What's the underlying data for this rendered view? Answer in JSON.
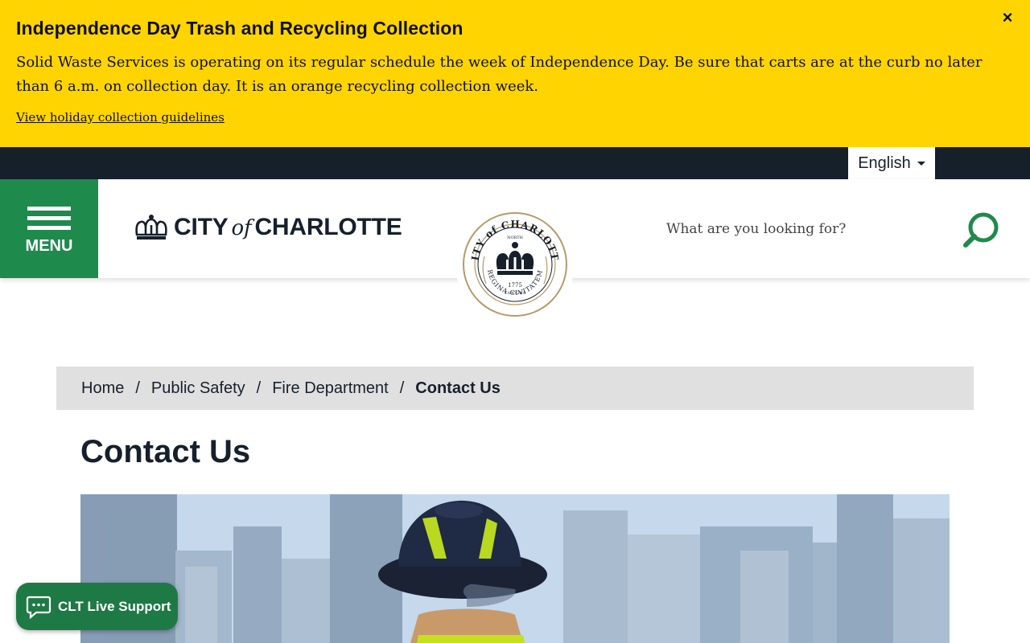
{
  "alert": {
    "title": "Independence Day Trash and Recycling Collection",
    "body": "Solid Waste Services is operating on its regular schedule the week of Independence Day. Be sure that carts are at the curb no later than 6 a.m. on collection day. It is an orange recycling collection week.",
    "link": "View holiday collection guidelines",
    "close_icon": "×",
    "bg_color": "#ffd400"
  },
  "utility": {
    "language": "English"
  },
  "header": {
    "menu_label": "MENU",
    "logo": {
      "part1": "CITY",
      "of": "of",
      "part2": "CHARLOTTE"
    },
    "seal": {
      "top": "CITY of CHARLOTTE",
      "north": "NORTH",
      "year": "1775",
      "carolina": "CAROLINA",
      "bottom": "REGINA CIVITATEM"
    },
    "search_placeholder": "What are you looking for?",
    "accent_color": "#1e8a4c"
  },
  "breadcrumb": {
    "items": [
      "Home",
      "Public Safety",
      "Fire Department"
    ],
    "current": "Contact Us",
    "separator": "/"
  },
  "main": {
    "title": "Contact Us"
  },
  "chat": {
    "label": "CLT Live Support"
  }
}
